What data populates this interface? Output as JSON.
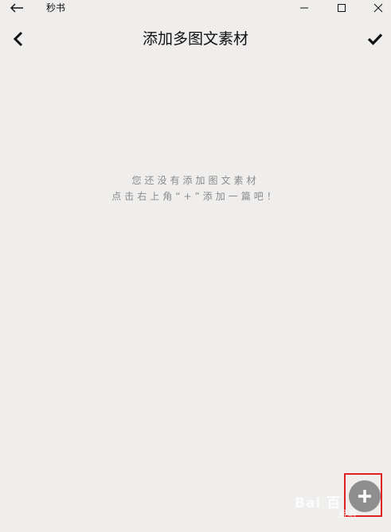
{
  "window": {
    "title": "秒书"
  },
  "header": {
    "title": "添加多图文素材"
  },
  "empty_state": {
    "line1": "您还没有添加图文素材",
    "line2": "点击右上角“+”添加一篇吧！"
  },
  "icons": {
    "back": "arrow-left",
    "minimize": "minimize",
    "maximize": "maximize",
    "close": "close",
    "nav_back": "chevron-left",
    "confirm": "check",
    "add": "plus"
  },
  "colors": {
    "background": "#efeeed",
    "fab": "#8e8e8e",
    "highlight": "#e02020",
    "empty_text": "#8a8a8a"
  },
  "watermark": {
    "brand": "Bai 百",
    "sub": "经验"
  }
}
